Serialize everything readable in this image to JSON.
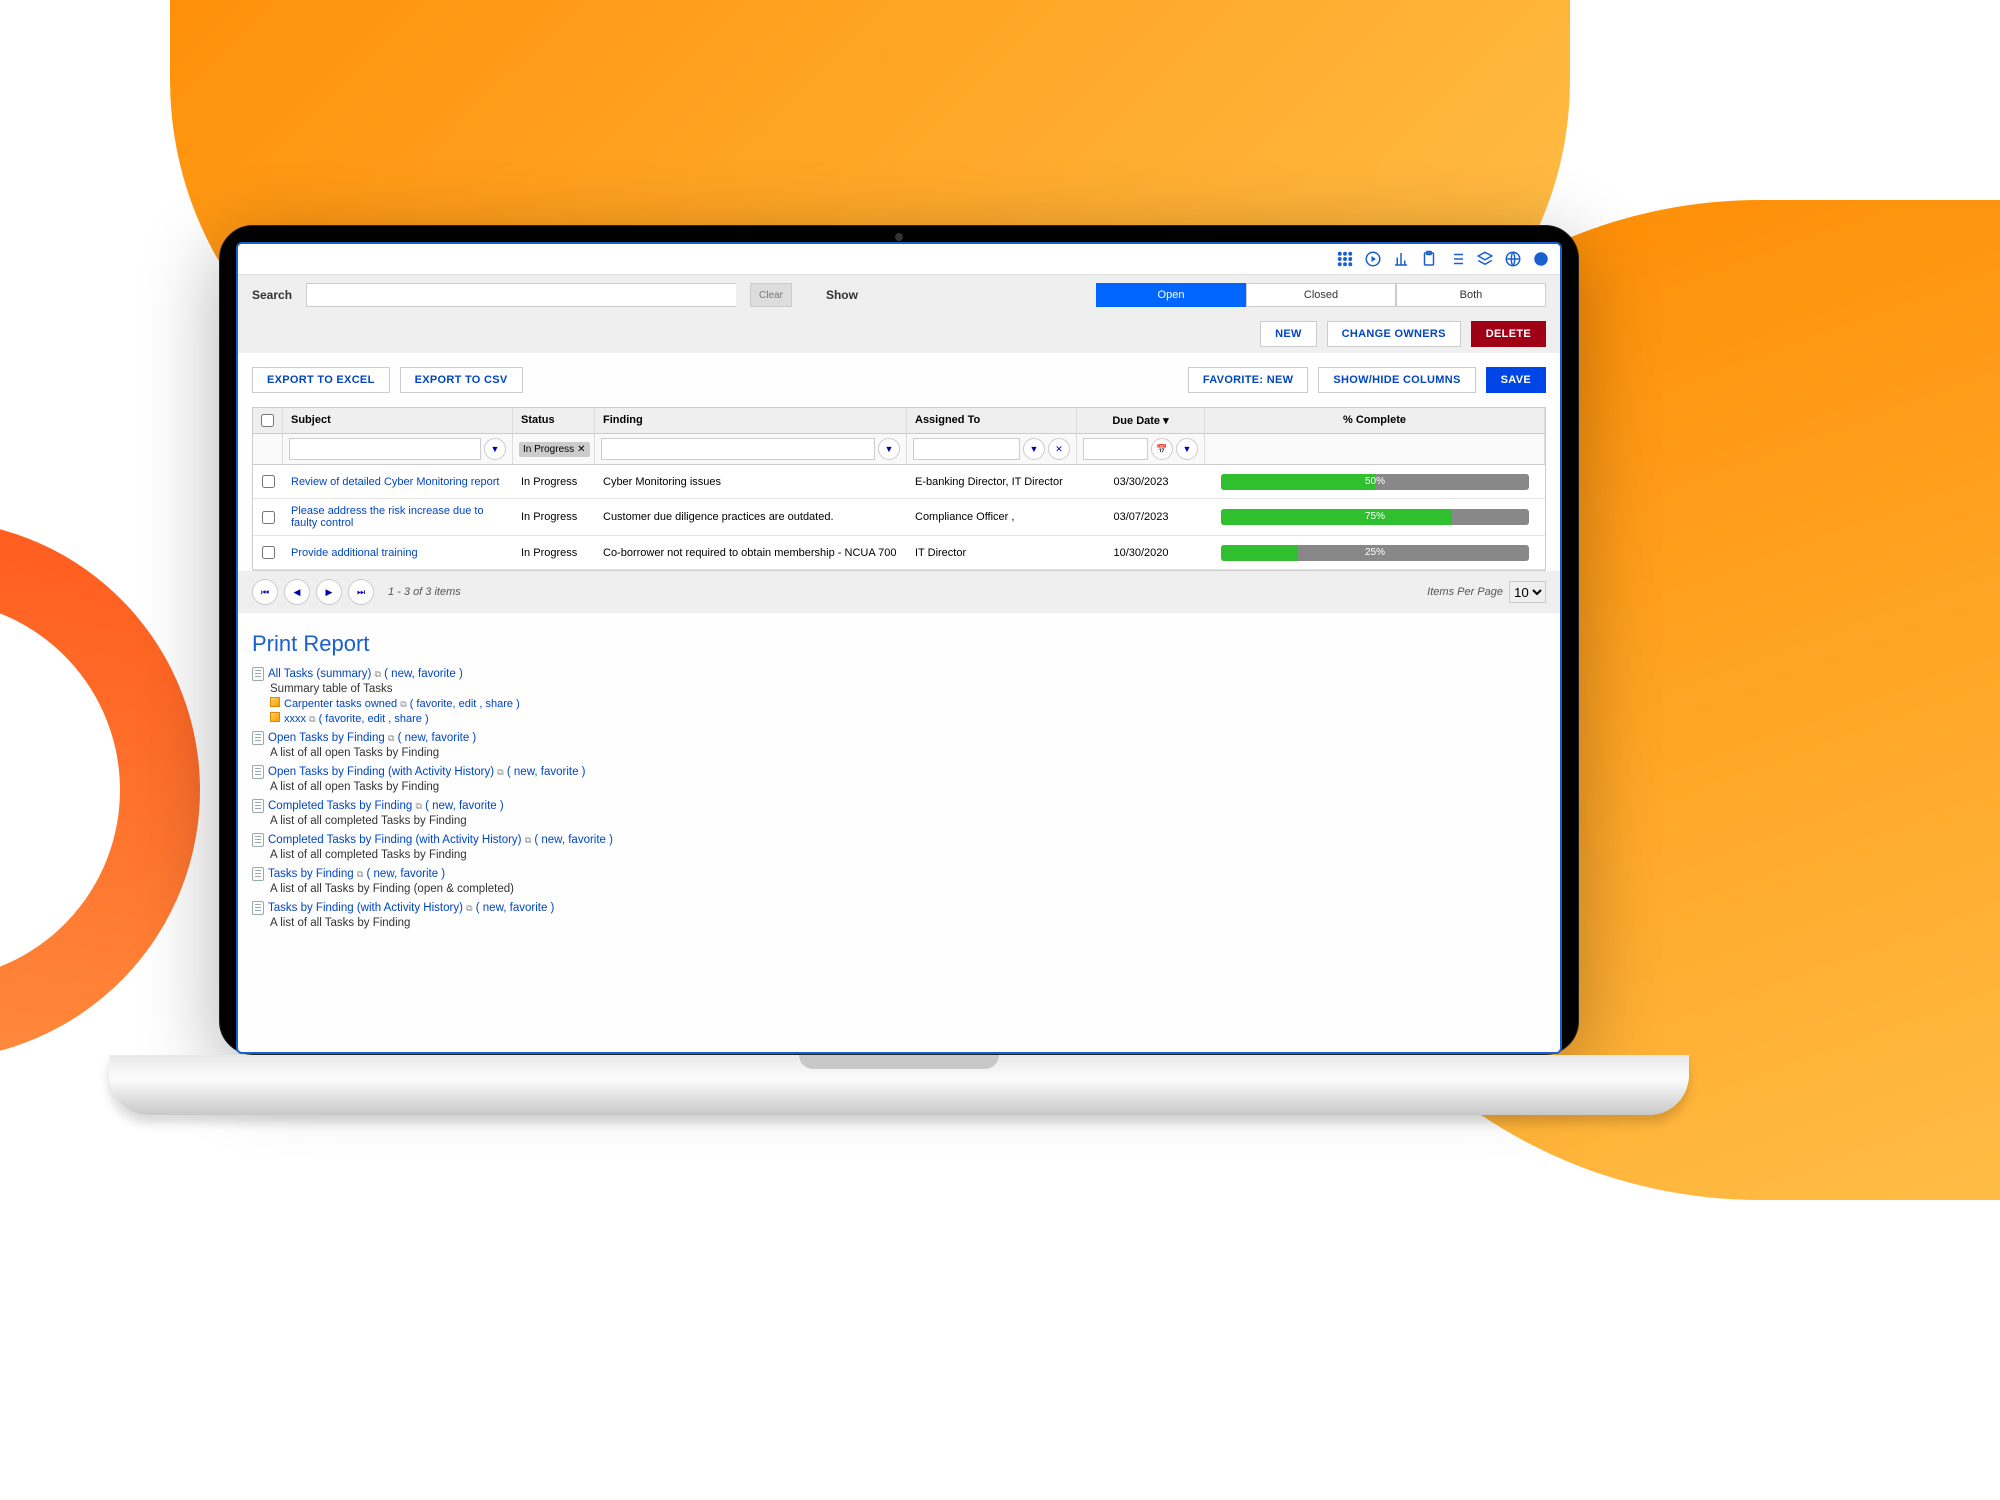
{
  "search": {
    "label": "Search",
    "value": "",
    "clear": "Clear"
  },
  "show": {
    "label": "Show",
    "options": [
      "Open",
      "Closed",
      "Both"
    ],
    "active": "Open"
  },
  "top_actions": {
    "new": "NEW",
    "change_owners": "CHANGE OWNERS",
    "delete": "DELETE"
  },
  "export": {
    "excel": "EXPORT TO EXCEL",
    "csv": "EXPORT TO CSV",
    "favorite": "FAVORITE: NEW",
    "showhide": "SHOW/HIDE COLUMNS",
    "save": "SAVE"
  },
  "columns": {
    "subject": "Subject",
    "status": "Status",
    "finding": "Finding",
    "assigned": "Assigned To",
    "due": "Due Date ▾",
    "pct": "% Complete"
  },
  "status_filter": "In Progress",
  "rows": [
    {
      "subject": "Review of detailed Cyber Monitoring report",
      "status": "In Progress",
      "finding": "Cyber Monitoring issues",
      "assigned": "E-banking Director, IT Director",
      "due": "03/30/2023",
      "pct": 50,
      "pct_label": "50%"
    },
    {
      "subject": "Please address the risk increase due to faulty control",
      "status": "In Progress",
      "finding": "Customer due diligence practices are outdated.",
      "assigned": "Compliance Officer ,",
      "due": "03/07/2023",
      "pct": 75,
      "pct_label": "75%"
    },
    {
      "subject": "Provide additional training",
      "status": "In Progress",
      "finding": "Co-borrower not required to obtain membership - NCUA 700",
      "assigned": "IT Director",
      "due": "10/30/2020",
      "pct": 25,
      "pct_label": "25%"
    }
  ],
  "pager": {
    "summary": "1 - 3 of 3 items",
    "ipp_label": "Items Per Page",
    "ipp_value": "10"
  },
  "print": {
    "title": "Print Report",
    "items": [
      {
        "title": "All Tasks (summary)",
        "meta": "( new, favorite )",
        "desc": "Summary table of Tasks",
        "subs": [
          {
            "title": "Carpenter tasks owned",
            "meta": "( favorite, edit , share )"
          },
          {
            "title": "xxxx",
            "meta": "( favorite, edit , share )"
          }
        ]
      },
      {
        "title": "Open Tasks by Finding",
        "meta": "( new, favorite )",
        "desc": "A list of all open Tasks by Finding"
      },
      {
        "title": "Open Tasks by Finding (with Activity History)",
        "meta": "( new, favorite )",
        "desc": "A list of all open Tasks by Finding"
      },
      {
        "title": "Completed Tasks by Finding",
        "meta": "( new, favorite )",
        "desc": "A list of all completed Tasks by Finding"
      },
      {
        "title": "Completed Tasks by Finding (with Activity History)",
        "meta": "( new, favorite )",
        "desc": "A list of all completed Tasks by Finding"
      },
      {
        "title": "Tasks by Finding",
        "meta": "( new, favorite )",
        "desc": "A list of all Tasks by Finding (open & completed)"
      },
      {
        "title": "Tasks by Finding (with Activity History)",
        "meta": "( new, favorite )",
        "desc": "A list of all Tasks by Finding"
      }
    ]
  }
}
